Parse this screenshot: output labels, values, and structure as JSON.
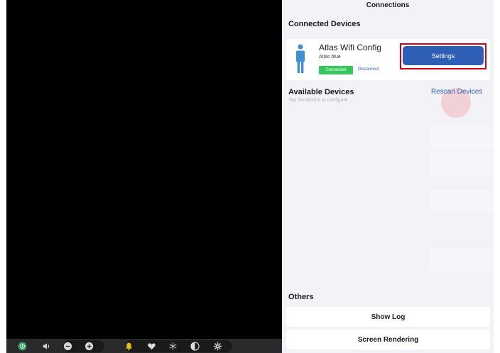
{
  "colors": {
    "accent": "#2e5fb6",
    "connected": "#34c759",
    "highlight": "#d0021b",
    "panel_bg": "#f2f2f7"
  },
  "toolbar": {
    "icons": [
      "power-icon",
      "volume-icon",
      "zoom-out-icon",
      "zoom-in-icon",
      "bell-icon",
      "heart-icon",
      "snowflake-icon",
      "contrast-icon",
      "gear-icon"
    ]
  },
  "panel": {
    "title": "Connections",
    "connected_header": "Connected Devices",
    "device": {
      "name": "Atlas Wifi Config",
      "subtitle": "Atlas blue",
      "status": "Connected",
      "disconnect_label": "Disconnect",
      "settings_label": "Settings",
      "icon": "person-icon"
    },
    "available_header": "Available Devices",
    "available_hint": "Tap the device to configure",
    "rescan_label": "Rescan Devices",
    "others_header": "Others",
    "show_log_label": "Show Log",
    "screen_rendering_label": "Screen Rendering"
  }
}
